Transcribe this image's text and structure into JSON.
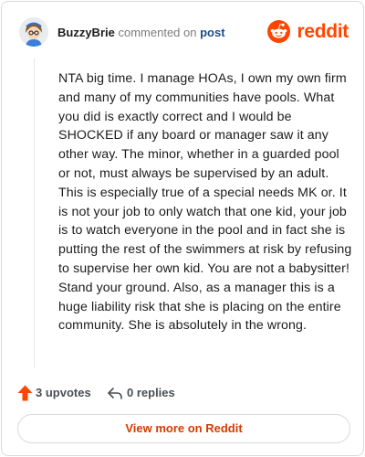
{
  "header": {
    "username": "BuzzyBrie",
    "action_text": "commented on",
    "post_link": "post",
    "brand_name": "reddit"
  },
  "comment": {
    "body": "NTA big time. I manage HOAs, I own my own firm and many of my communities have pools. What you did is exactly correct and I would be SHOCKED if any board or manager saw it any other way. The minor, whether in a guarded pool or not, must always be supervised by an adult. This is especially true of a special needs MK or. It is not your job to only watch that one kid, your job is to watch everyone in the pool and in fact she is putting the rest of the swimmers at risk by refusing to supervise her own kid. You are not a babysitter! Stand your ground. Also, as a manager this is a huge liability risk that she is placing on the entire community. She is absolutely in the wrong."
  },
  "actions": {
    "upvotes": "3 upvotes",
    "replies": "0 replies"
  },
  "footer": {
    "view_more": "View more on Reddit"
  },
  "icons": {
    "brand_logo": "reddit-logo-icon",
    "upvote": "upvote-arrow-icon",
    "reply": "reply-arrow-icon",
    "avatar": "snoo-avatar"
  },
  "colors": {
    "brand": "#ff4500",
    "link": "#1a4f8b",
    "view_more_text": "#d93a00"
  }
}
